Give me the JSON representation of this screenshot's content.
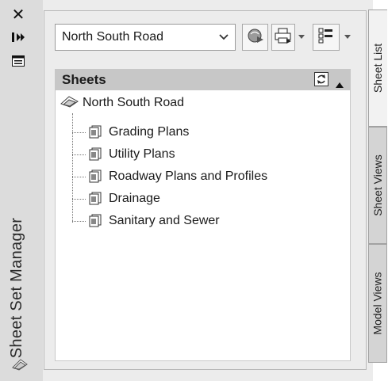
{
  "palette": {
    "title": "Sheet Set Manager",
    "icons": {
      "close": "close-icon",
      "autohide": "autohide-pin-icon",
      "properties": "properties-icon",
      "footer": "sheet-set-icon"
    },
    "close_glyph": "✕"
  },
  "sheet_set_selector": {
    "value": "North South Road"
  },
  "toolbar": {
    "buttons": [
      {
        "name": "publish-to-dwf-button",
        "icon": "publish-icon"
      },
      {
        "name": "publish-button",
        "icon": "plot-icon",
        "has_dropdown": true
      },
      {
        "name": "sheet-selections-button",
        "icon": "sheet-selections-icon",
        "has_dropdown": true
      }
    ]
  },
  "sheets_panel": {
    "header": "Sheets",
    "root": "North South Road",
    "items": [
      "Grading Plans",
      "Utility Plans",
      "Roadway Plans and Profiles",
      "Drainage",
      "Sanitary and Sewer"
    ]
  },
  "tabs": [
    {
      "label": "Sheet List",
      "active": true
    },
    {
      "label": "Sheet Views",
      "active": false
    },
    {
      "label": "Model Views",
      "active": false
    }
  ],
  "colors": {
    "header_bg": "#c7c7c7",
    "panel_bg": "#ececec",
    "tree_bg": "#ffffff"
  }
}
